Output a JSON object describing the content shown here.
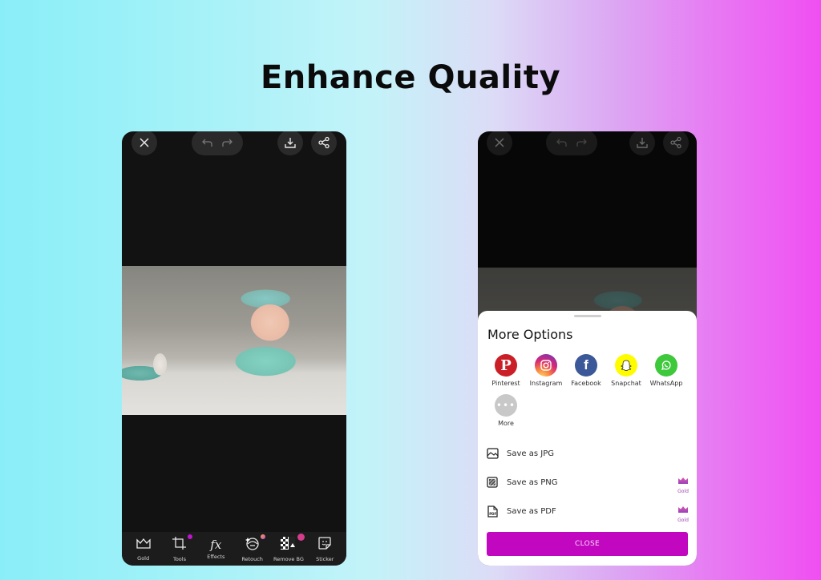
{
  "headline": "Enhance Quality",
  "left_phone": {
    "topbar": {
      "close_icon": "close-icon",
      "undo_icon": "undo-icon",
      "redo_icon": "redo-icon",
      "download_icon": "download-icon",
      "share_icon": "share-icon"
    },
    "toolbar": [
      {
        "label": "Gold",
        "icon": "crown-icon",
        "dot": false
      },
      {
        "label": "Tools",
        "icon": "crop-icon",
        "dot": "purple"
      },
      {
        "label": "Effects",
        "icon": "fx-icon",
        "dot": false
      },
      {
        "label": "Retouch",
        "icon": "retouch-icon",
        "dot": "orange"
      },
      {
        "label": "Remove BG",
        "icon": "remove-bg-icon",
        "dot": "badge"
      },
      {
        "label": "Sticker",
        "icon": "sticker-icon",
        "dot": false
      }
    ]
  },
  "right_phone": {
    "sheet": {
      "title": "More Options",
      "share_targets": [
        {
          "label": "Pinterest",
          "icon": "pinterest-icon",
          "color": "#cb1f27"
        },
        {
          "label": "Instagram",
          "icon": "instagram-icon",
          "color": "#d62976"
        },
        {
          "label": "Facebook",
          "icon": "facebook-icon",
          "color": "#3b5998"
        },
        {
          "label": "Snapchat",
          "icon": "snapchat-icon",
          "color": "#fffc00"
        },
        {
          "label": "WhatsApp",
          "icon": "whatsapp-icon",
          "color": "#3ec83b"
        }
      ],
      "more": {
        "label": "More",
        "icon": "more-icon",
        "color": "#c8c8c8"
      },
      "save_options": [
        {
          "label": "Save as JPG",
          "icon": "image-icon",
          "gold": false
        },
        {
          "label": "Save as PNG",
          "icon": "png-icon",
          "gold": true
        },
        {
          "label": "Save as PDF",
          "icon": "pdf-icon",
          "gold": true
        }
      ],
      "gold_label": "Gold",
      "close_label": "CLOSE"
    }
  },
  "colors": {
    "accent": "#c207c0",
    "gold_badge": "#a448b8"
  }
}
